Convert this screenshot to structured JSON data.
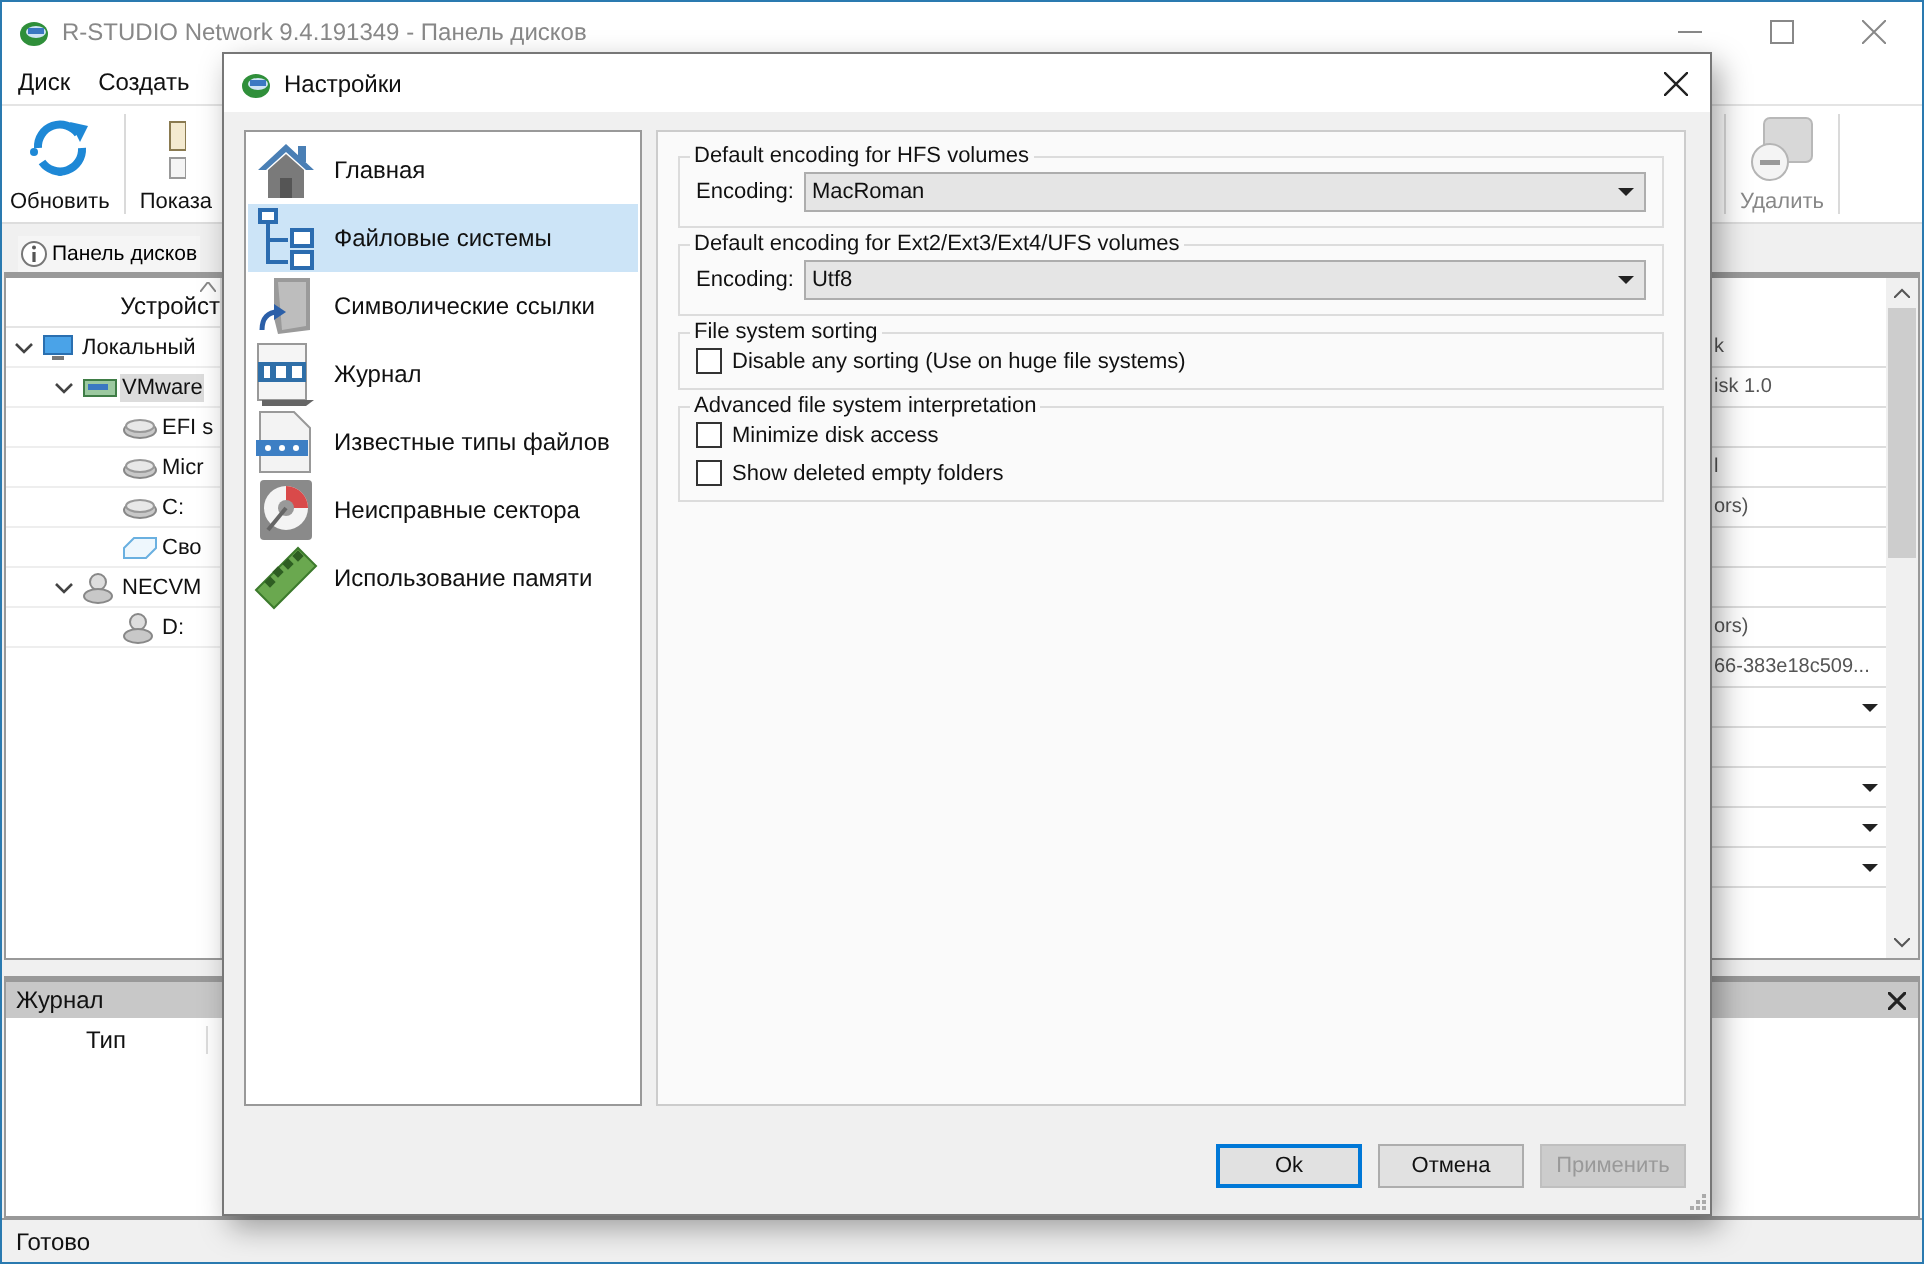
{
  "app": {
    "title": "R-STUDIO Network 9.4.191349 - Панель дисков",
    "menu": [
      "Диск",
      "Создать"
    ],
    "toolbar": [
      {
        "label": "Обновить",
        "kind": "refresh",
        "disabled": false
      },
      {
        "label": "Показа",
        "kind": "document",
        "disabled": false
      },
      {
        "label": "Удалить",
        "kind": "delete",
        "disabled": true
      }
    ],
    "panel_tab": "Панель дисков",
    "tree": {
      "column": "Устройст",
      "items": [
        {
          "label": "Локальный",
          "kind": "computer",
          "expanded": true,
          "selected": false,
          "children": [
            {
              "label": "VMware",
              "kind": "disk",
              "expanded": true,
              "selected": true,
              "children": [
                {
                  "label": "EFI s",
                  "kind": "partition",
                  "selected": false
                },
                {
                  "label": "Micr",
                  "kind": "partition",
                  "selected": false
                },
                {
                  "label": "C:",
                  "kind": "partition",
                  "selected": false
                },
                {
                  "label": "Сво",
                  "kind": "free",
                  "selected": false
                }
              ]
            },
            {
              "label": "NECVM",
              "kind": "optical",
              "expanded": true,
              "selected": false,
              "children": [
                {
                  "label": "D:",
                  "kind": "optical",
                  "selected": false
                }
              ]
            }
          ]
        }
      ]
    },
    "properties": [
      {
        "value": "k",
        "dropdown": false
      },
      {
        "value": "isk 1.0",
        "dropdown": false
      },
      {
        "dropdown": false
      },
      {
        "value": "l",
        "dropdown": false
      },
      {
        "value": "ors)",
        "dropdown": false
      },
      {
        "dropdown": false
      },
      {
        "dropdown": false
      },
      {
        "value": "ors)",
        "dropdown": false
      },
      {
        "value": "66-383e18c509...",
        "dropdown": false
      },
      {
        "dropdown": true
      },
      {
        "dropdown": false
      },
      {
        "dropdown": true
      },
      {
        "dropdown": true
      },
      {
        "dropdown": true
      }
    ],
    "log": {
      "title": "Журнал",
      "columns": [
        "Тип"
      ]
    },
    "status": "Готово"
  },
  "dialog": {
    "title": "Настройки",
    "nav": [
      {
        "label": "Главная",
        "kind": "home",
        "selected": false
      },
      {
        "label": "Файловые системы",
        "kind": "filesystems",
        "selected": true
      },
      {
        "label": "Символические ссылки",
        "kind": "symlinks",
        "selected": false
      },
      {
        "label": "Журнал",
        "kind": "log",
        "selected": false
      },
      {
        "label": "Известные типы файлов",
        "kind": "filetypes",
        "selected": false
      },
      {
        "label": "Неисправные сектора",
        "kind": "badsectors",
        "selected": false
      },
      {
        "label": "Использование памяти",
        "kind": "memory",
        "selected": false
      }
    ],
    "groups": [
      {
        "title": "Default encoding for HFS volumes",
        "fields": [
          {
            "kind": "combo",
            "label": "Encoding:",
            "value": "MacRoman"
          }
        ]
      },
      {
        "title": "Default encoding for Ext2/Ext3/Ext4/UFS volumes",
        "fields": [
          {
            "kind": "combo",
            "label": "Encoding:",
            "value": "Utf8"
          }
        ]
      },
      {
        "title": "File system sorting",
        "fields": [
          {
            "kind": "checkbox",
            "label": "Disable any sorting (Use on huge file systems)",
            "checked": false
          }
        ]
      },
      {
        "title": "Advanced file system interpretation",
        "fields": [
          {
            "kind": "checkbox",
            "label": "Minimize disk access",
            "checked": false
          },
          {
            "kind": "checkbox",
            "label": "Show deleted empty folders",
            "checked": false
          }
        ]
      }
    ],
    "buttons": [
      {
        "label": "Ok",
        "default": true,
        "disabled": false
      },
      {
        "label": "Отмена",
        "default": false,
        "disabled": false
      },
      {
        "label": "Применить",
        "default": false,
        "disabled": true
      }
    ]
  }
}
